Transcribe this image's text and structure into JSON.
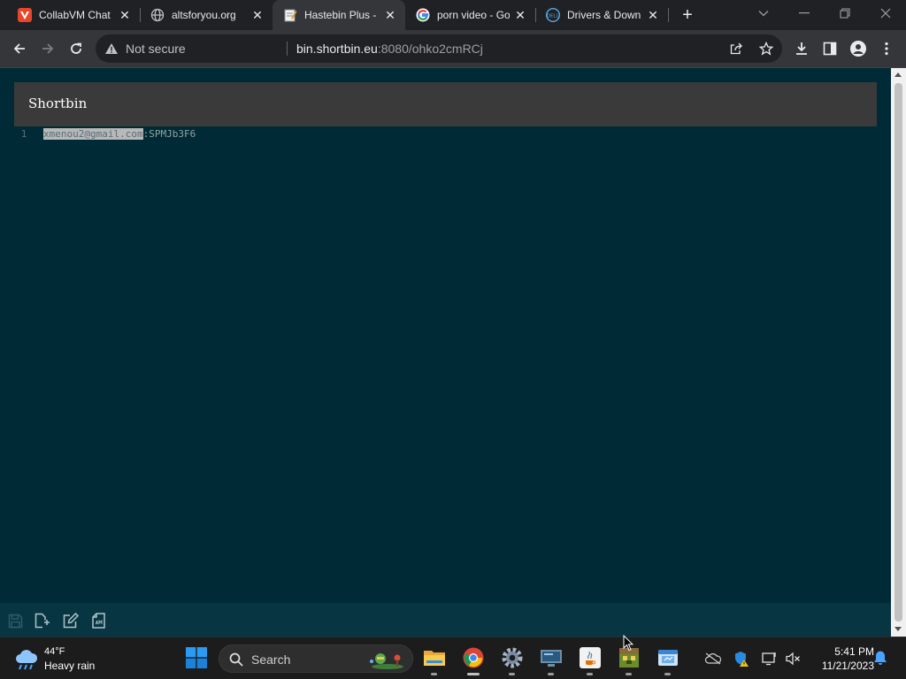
{
  "browser": {
    "tabs": [
      {
        "title": "CollabVM Chat",
        "favicon": "collabvm-icon",
        "active": false
      },
      {
        "title": "altsforyou.org",
        "favicon": "globe-icon",
        "active": false
      },
      {
        "title": "Hastebin Plus -",
        "favicon": "notepad-icon",
        "active": true
      },
      {
        "title": "porn video - Go",
        "favicon": "google-icon",
        "active": false
      },
      {
        "title": "Drivers & Down",
        "favicon": "dell-icon",
        "active": false
      }
    ],
    "security_label": "Not secure",
    "url_host": "bin.shortbin.eu",
    "url_rest": ":8080/ohko2cmRCj"
  },
  "page": {
    "brand": "Shortbin",
    "lines": [
      {
        "number": "1",
        "selected": "xmenou2@gmail.com",
        "rest": ":SPMJb3F6"
      }
    ]
  },
  "taskbar": {
    "weather_temp": "44°F",
    "weather_condition": "Heavy rain",
    "search_label": "Search",
    "time": "5:41 PM",
    "date": "11/21/2023"
  },
  "colors": {
    "page_bg": "#002b36",
    "header_bg": "#3a3a3a",
    "footer_bg": "#073642",
    "browser_frame": "#202124",
    "toolbar": "#35363a"
  }
}
